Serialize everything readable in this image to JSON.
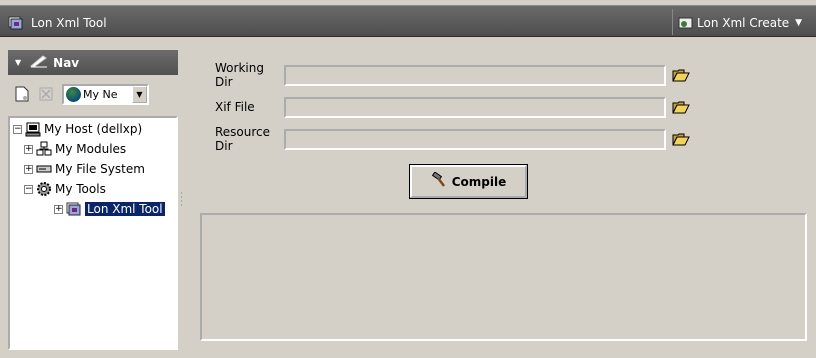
{
  "titlebar": {
    "title": "Lon Xml Tool",
    "view_selector": "Lon Xml Create"
  },
  "nav": {
    "header": "Nav",
    "space_combo": "My Ne",
    "tree": [
      {
        "label": "My Host (dellxp)",
        "expander": "−",
        "icon": "computer-icon"
      },
      {
        "label": "My Modules",
        "expander": "+",
        "icon": "modules-icon"
      },
      {
        "label": "My File System",
        "expander": "+",
        "icon": "drive-icon"
      },
      {
        "label": "My Tools",
        "expander": "−",
        "icon": "tools-gear-icon"
      },
      {
        "label": "Lon Xml Tool",
        "expander": "+",
        "icon": "lon-xml-tool-icon",
        "selected": true
      }
    ]
  },
  "form": {
    "working_dir": {
      "label": "Working Dir",
      "value": ""
    },
    "xif_file": {
      "label": "Xif File",
      "value": ""
    },
    "resource_dir": {
      "label": "Resource Dir",
      "value": ""
    },
    "compile_label": "Compile",
    "output": ""
  },
  "colors": {
    "background": "#d4d0c8",
    "titlebar": "#5a5a5a",
    "selection": "#0a246a"
  }
}
